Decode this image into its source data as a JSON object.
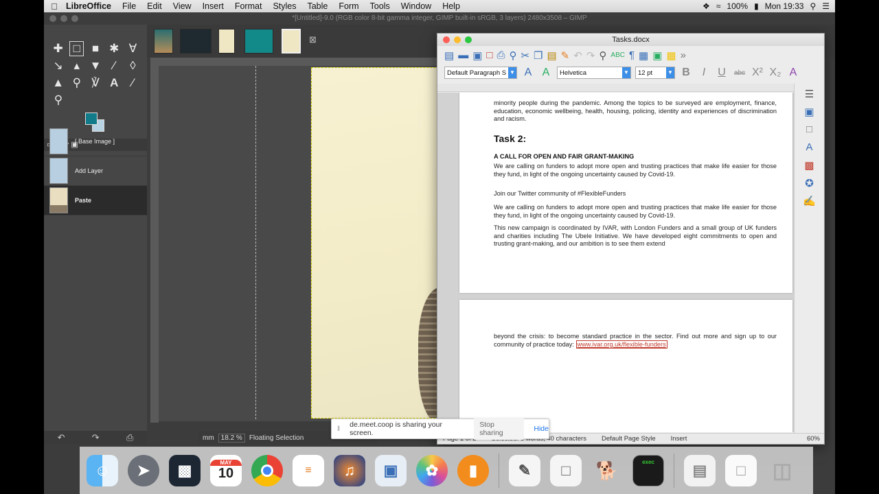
{
  "menubar": {
    "app_name": "LibreOffice",
    "items": [
      "File",
      "Edit",
      "View",
      "Insert",
      "Format",
      "Styles",
      "Table",
      "Form",
      "Tools",
      "Window",
      "Help"
    ],
    "battery": "100%",
    "clock": "Mon 19:33"
  },
  "gimp": {
    "title": "*[Untitled]-9.0 (RGB color 8-bit gamma integer, GIMP built-in sRGB, 3 layers) 2480x3508 – GIMP",
    "layers": [
      {
        "name": "[ Base Image ]"
      },
      {
        "name": "Add Layer"
      },
      {
        "name": "Paste"
      }
    ],
    "status": {
      "unit": "mm",
      "zoom": "18.2 %",
      "message": "Floating Selection"
    },
    "colors": {
      "fg": "#127b8a",
      "bg": "#b7d3e3"
    }
  },
  "libreoffice": {
    "window_title": "Tasks.docx",
    "para_style": "Default Paragraph S",
    "font_name": "Helvetica",
    "font_size": "12 pt",
    "doc": {
      "p_intro": "minority people during the pandemic. Among the topics to be surveyed are employment, finance, education, economic wellbeing, health, housing, policing, identity and experiences of discrimination and racism.",
      "task_heading": "Task 2:",
      "subheading": "A CALL FOR OPEN AND FAIR GRANT-MAKING",
      "p1": "We are calling on funders to adopt more open and trusting practices that make life easier for those they fund, in light of the ongoing uncertainty caused by Covid-19.",
      "p2": "Join our Twitter community of #FlexibleFunders",
      "p3": "We are calling on funders to adopt more open and trusting practices that make life easier for those they fund, in light of the ongoing uncertainty caused by Covid-19.",
      "p4": "This new campaign is coordinated by IVAR, with London Funders and a small group of UK funders and charities including The Ubele Initiative. We have developed eight commitments to open and trusting grant-making, and our ambition is to see them extend",
      "p5_text": "beyond the crisis: to become standard practice in the sector. Find out more and sign up to our community of practice today:",
      "p5_link": "www.ivar.org.uk/flexible-funders"
    },
    "statusbar": {
      "page": "Page 1 of 2",
      "selection": "Selected: 5 words, 40 characters",
      "page_style": "Default Page Style",
      "mode": "Insert",
      "zoom": "60%"
    }
  },
  "share_notice": {
    "message": "de.meet.coop is sharing your screen.",
    "stop_label": "Stop sharing",
    "hide_label": "Hide"
  },
  "dock": {
    "calendar_month": "MAY",
    "calendar_day": "10",
    "icons": [
      "finder-icon",
      "launchpad-icon",
      "screen-icon",
      "calendar-icon",
      "chrome-icon",
      "reminders-icon",
      "audacity-icon",
      "preview-icon",
      "photos-icon",
      "books-icon",
      "textedit-icon",
      "libreoffice-icon",
      "gimp-icon",
      "terminal-icon",
      "document-icon",
      "folder-icon",
      "trash-icon"
    ],
    "terminal_label": "exec"
  }
}
